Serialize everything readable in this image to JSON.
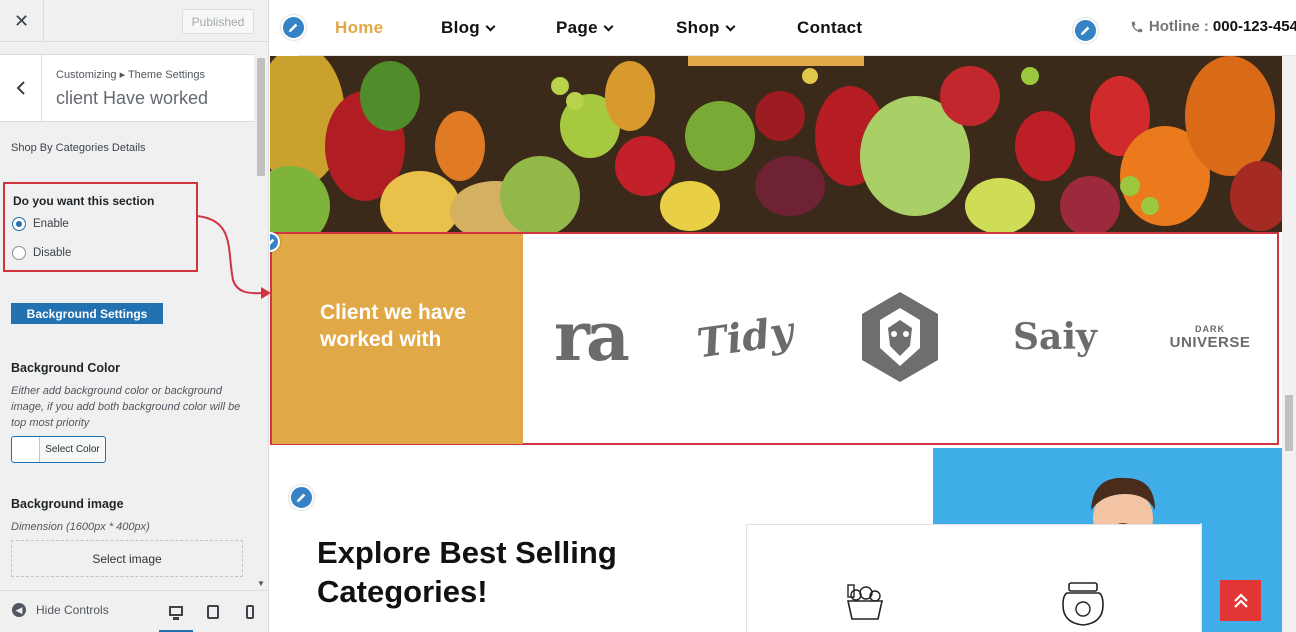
{
  "sidebar": {
    "close_icon": "close-icon",
    "publish_label": "Published",
    "breadcrumb": "Customizing ▸ Theme Settings",
    "panel_title": "client Have worked",
    "section_label": "Shop By Categories Details",
    "section_toggle": {
      "title": "Do you want this section",
      "options": [
        "Enable",
        "Disable"
      ],
      "selected": "Enable"
    },
    "bg_settings_label": "Background Settings",
    "bg_color": {
      "title": "Background Color",
      "description": "Either add background color or background image, if you add both background color will be top most priority",
      "button_label": "Select Color"
    },
    "bg_image": {
      "title": "Background image",
      "dimension": "Dimension (1600px * 400px)",
      "button_label": "Select image"
    },
    "footer": {
      "hide_label": "Hide Controls"
    }
  },
  "preview": {
    "nav": {
      "items": [
        {
          "label": "Home",
          "active": true,
          "dropdown": false
        },
        {
          "label": "Blog",
          "active": false,
          "dropdown": true
        },
        {
          "label": "Page",
          "active": false,
          "dropdown": true
        },
        {
          "label": "Shop",
          "active": false,
          "dropdown": true
        },
        {
          "label": "Contact",
          "active": false,
          "dropdown": false
        }
      ],
      "hotline_label": "Hotline :",
      "hotline_number": "000-123-454"
    },
    "clients": {
      "title": "Client we have worked with",
      "logos": [
        {
          "text": "ra"
        },
        {
          "text": "Tidy"
        },
        {
          "text": ""
        },
        {
          "text": "Saiy"
        },
        {
          "text": "DARK UNIVERSE",
          "top": "DARK",
          "bottom": "UNIVERSE"
        }
      ]
    },
    "categories": {
      "title": "Explore Best Selling Categories!"
    }
  },
  "colors": {
    "accent": "#e0a846",
    "highlight": "#d0343f",
    "wp_blue": "#2271b1",
    "back_to_top": "#e23636",
    "photo_bg": "#3faee8"
  }
}
